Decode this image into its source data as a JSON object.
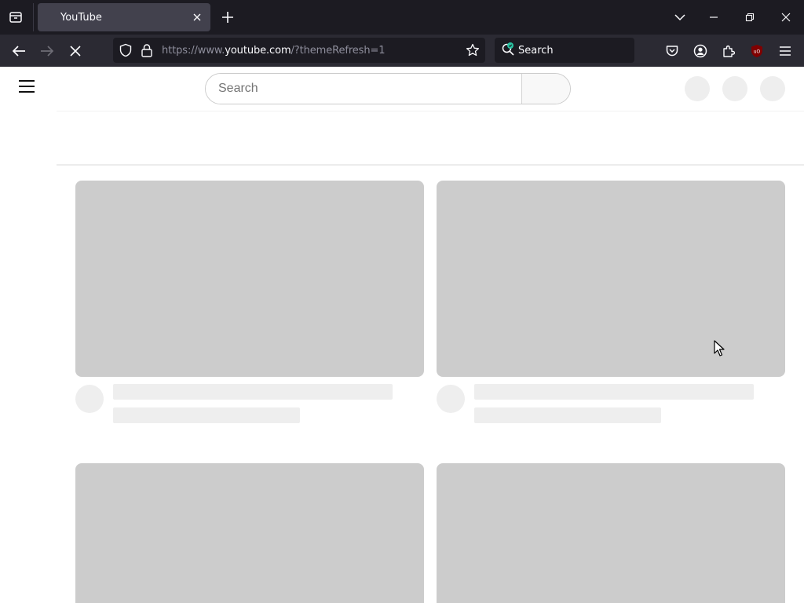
{
  "browser": {
    "tab": {
      "title": "YouTube"
    },
    "url": {
      "prefix": "https://www.",
      "host": "youtube.com",
      "suffix": "/?themeRefresh=1"
    },
    "search_placeholder": "Search",
    "addon_badge": "uO"
  },
  "youtube": {
    "search_placeholder": "Search"
  },
  "colors": {
    "chrome_dark": "#1c1b22",
    "toolbar": "#2b2a33",
    "skeleton_thumb": "#cccccc",
    "skeleton_line": "#eeeeee",
    "ublock_red": "#800000"
  }
}
